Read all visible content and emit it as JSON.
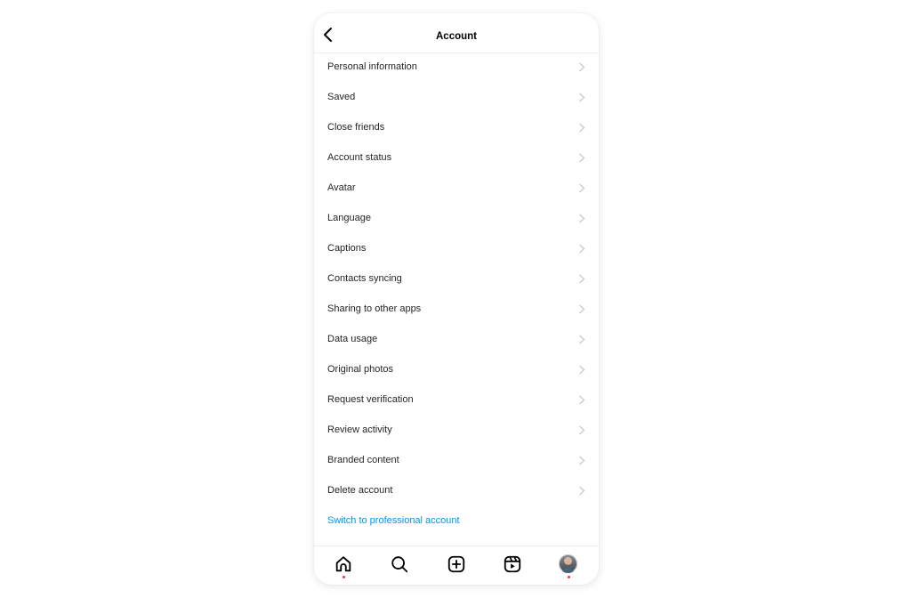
{
  "header": {
    "title": "Account",
    "back_icon": "chevron-left-icon"
  },
  "menu": {
    "items": [
      {
        "label": "Personal information"
      },
      {
        "label": "Saved"
      },
      {
        "label": "Close friends"
      },
      {
        "label": "Account status"
      },
      {
        "label": "Avatar"
      },
      {
        "label": "Language"
      },
      {
        "label": "Captions"
      },
      {
        "label": "Contacts syncing"
      },
      {
        "label": "Sharing to other apps"
      },
      {
        "label": "Data usage"
      },
      {
        "label": "Original photos"
      },
      {
        "label": "Request verification"
      },
      {
        "label": "Review activity"
      },
      {
        "label": "Branded content"
      },
      {
        "label": "Delete account"
      }
    ],
    "link": {
      "label": "Switch to professional account"
    }
  },
  "bottom_nav": {
    "items": [
      {
        "name": "home",
        "icon": "home-icon",
        "notification_dot": true
      },
      {
        "name": "search",
        "icon": "search-icon",
        "notification_dot": false
      },
      {
        "name": "create",
        "icon": "plus-square-icon",
        "notification_dot": false
      },
      {
        "name": "reels",
        "icon": "reels-icon",
        "notification_dot": false
      },
      {
        "name": "profile",
        "icon": "profile-avatar",
        "notification_dot": true
      }
    ]
  },
  "colors": {
    "link": "#0095f6",
    "notification_dot": "#ff3040",
    "text": "#262626",
    "chevron": "#c7c7c7"
  }
}
